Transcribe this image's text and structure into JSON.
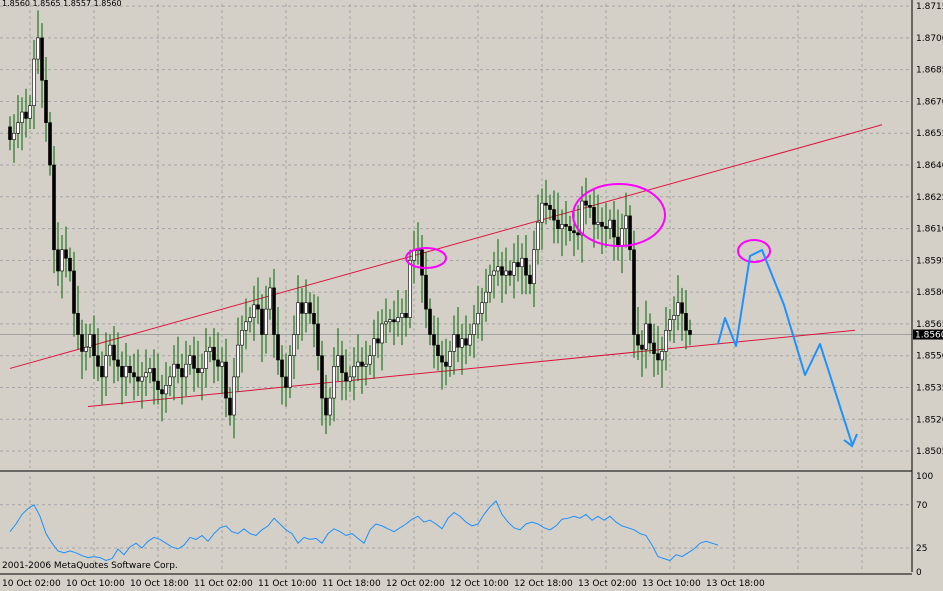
{
  "window": {
    "ohlc_readout": "1.8560 1.8565 1.8557 1.8560",
    "copyright": "2001-2006 MetaQuotes Software Corp."
  },
  "colors": {
    "background": "#d4d0c8",
    "grid": "#a6a6a6",
    "candle_bull": "#ffffff",
    "candle_bear": "#000000",
    "candle_wick": "#006400",
    "trendline": "#dc143c",
    "annotation_circle": "#ff00ff",
    "forecast_path": "#1e90ff",
    "indicator_line": "#1e90ff"
  },
  "chart_data": [
    {
      "type": "candlestick",
      "series": [
        {
          "name": "",
          "note": "price candles"
        }
      ],
      "ylim": [
        1.8497,
        1.8716
      ],
      "y_ticks": [
        1.8505,
        1.852,
        1.8535,
        1.855,
        1.8565,
        1.858,
        1.8595,
        1.861,
        1.8625,
        1.864,
        1.8655,
        1.867,
        1.8685,
        1.87,
        1.8715
      ],
      "y_tick_labels": [
        "1.8505",
        "1.8520",
        "1.8535",
        "1.8550",
        "1.8565",
        "1.8580",
        "1.8595",
        "1.8610",
        "1.8625",
        "1.8640",
        "1.8655",
        "1.8670",
        "1.8685",
        "1.8700",
        "1.8715"
      ],
      "current_price": 1.856,
      "current_price_label": "1.8560",
      "x_tick_labels": [
        "10 Oct 02:00",
        "10 Oct 10:00",
        "10 Oct 18:00",
        "11 Oct 02:00",
        "11 Oct 10:00",
        "11 Oct 18:00",
        "12 Oct 02:00",
        "12 Oct 10:00",
        "12 Oct 18:00",
        "13 Oct 02:00",
        "13 Oct 10:00",
        "13 Oct 18:00"
      ],
      "closes": [
        1.8652,
        1.8655,
        1.866,
        1.8665,
        1.8662,
        1.8668,
        1.869,
        1.87,
        1.868,
        1.866,
        1.864,
        1.86,
        1.859,
        1.86,
        1.8596,
        1.859,
        1.857,
        1.856,
        1.8552,
        1.8554,
        1.856,
        1.855,
        1.8545,
        1.854,
        1.855,
        1.8555,
        1.8548,
        1.8545,
        1.854,
        1.8545,
        1.8542,
        1.854,
        1.8538,
        1.854,
        1.8542,
        1.8544,
        1.8538,
        1.8534,
        1.8532,
        1.8536,
        1.854,
        1.8546,
        1.8544,
        1.854,
        1.8546,
        1.855,
        1.8544,
        1.8542,
        1.8544,
        1.8552,
        1.8554,
        1.8548,
        1.8545,
        1.8547,
        1.853,
        1.8522,
        1.854,
        1.8555,
        1.8562,
        1.8566,
        1.8568,
        1.8574,
        1.8572,
        1.856,
        1.8572,
        1.8582,
        1.856,
        1.8548,
        1.854,
        1.8535,
        1.855,
        1.856,
        1.8575,
        1.857,
        1.8575,
        1.857,
        1.8565,
        1.855,
        1.853,
        1.8522,
        1.853,
        1.8545,
        1.855,
        1.8542,
        1.8538,
        1.854,
        1.8545,
        1.8547,
        1.8545,
        1.8546,
        1.855,
        1.8558,
        1.8556,
        1.8565,
        1.8566,
        1.8567,
        1.8566,
        1.8568,
        1.857,
        1.8568,
        1.8595,
        1.86,
        1.86,
        1.8588,
        1.8572,
        1.856,
        1.8555,
        1.855,
        1.8547,
        1.8545,
        1.8552,
        1.856,
        1.8554,
        1.8558,
        1.8555,
        1.856,
        1.8565,
        1.857,
        1.8575,
        1.858,
        1.8588,
        1.859,
        1.8592,
        1.8588,
        1.859,
        1.8588,
        1.8594,
        1.8592,
        1.8596,
        1.8588,
        1.8584,
        1.86,
        1.8613,
        1.8622,
        1.8621,
        1.8619,
        1.8614,
        1.861,
        1.8612,
        1.8611,
        1.8609,
        1.8608,
        1.8607,
        1.8623,
        1.8621,
        1.862,
        1.8612,
        1.8613,
        1.8611,
        1.861,
        1.8614,
        1.8606,
        1.8602,
        1.861,
        1.8616,
        1.86,
        1.856,
        1.8555,
        1.8553,
        1.8565,
        1.8556,
        1.8551,
        1.8548,
        1.8552,
        1.8562,
        1.8567,
        1.8569,
        1.8575,
        1.857,
        1.8562,
        1.856
      ],
      "candle_x_start": 10,
      "candle_spacing": 4
    },
    {
      "type": "line",
      "series": [
        {
          "name": "",
          "note": "oscillator"
        }
      ],
      "ylim": [
        0,
        100
      ],
      "y_ticks": [
        0,
        25,
        70,
        100
      ],
      "y_tick_labels": [
        "0",
        "25",
        "70",
        "100"
      ],
      "values": [
        42,
        50,
        60,
        66,
        70,
        58,
        40,
        30,
        22,
        20,
        22,
        20,
        17,
        15,
        16,
        15,
        12,
        14,
        24,
        18,
        26,
        30,
        25,
        32,
        36,
        34,
        30,
        26,
        24,
        28,
        36,
        34,
        38,
        32,
        40,
        46,
        48,
        42,
        40,
        45,
        40,
        38,
        44,
        48,
        56,
        50,
        44,
        40,
        30,
        36,
        34,
        35,
        30,
        40,
        45,
        42,
        38,
        40,
        35,
        30,
        44,
        50,
        48,
        45,
        42,
        46,
        50,
        55,
        58,
        52,
        54,
        50,
        45,
        56,
        62,
        58,
        52,
        48,
        50,
        60,
        68,
        74,
        60,
        52,
        46,
        44,
        50,
        52,
        50,
        46,
        44,
        48,
        55,
        56,
        58,
        56,
        60,
        54,
        58,
        54,
        58,
        52,
        48,
        46,
        44,
        40,
        38,
        28,
        16,
        14,
        12,
        18,
        16,
        20,
        24,
        30,
        32,
        30,
        28
      ]
    }
  ]
}
